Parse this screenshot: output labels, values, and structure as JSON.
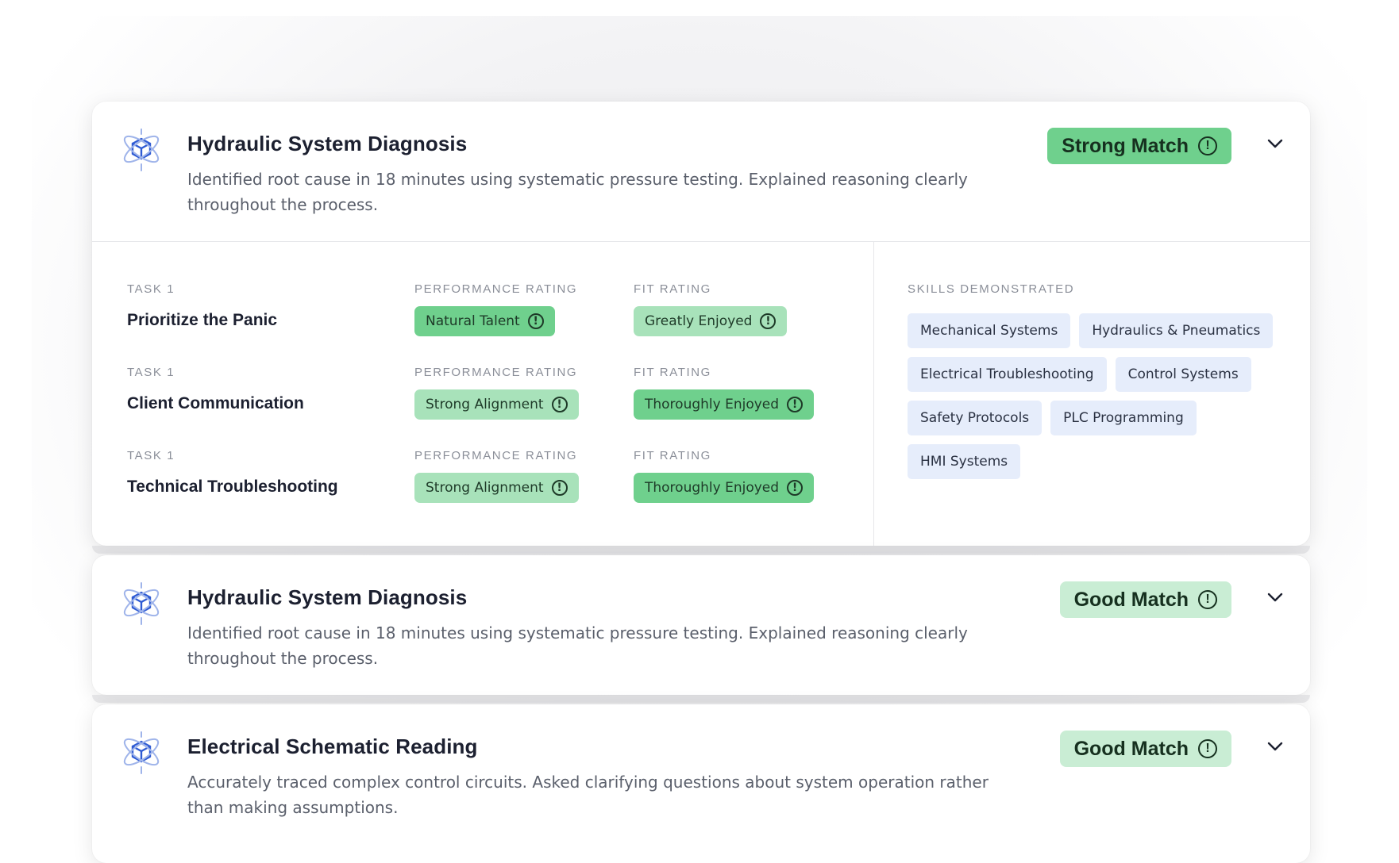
{
  "cards": [
    {
      "title": "Hydraulic System Diagnosis",
      "description": "Identified root cause in 18 minutes using systematic pressure testing. Explained reasoning clearly throughout the process.",
      "match": "Strong Match",
      "expanded": true,
      "tasks": [
        {
          "task_label": "TASK 1",
          "name": "Prioritize the Panic",
          "performance_label": "PERFORMANCE RATING",
          "performance": "Natural Talent",
          "fit_label": "FIT RATING",
          "fit": "Greatly Enjoyed"
        },
        {
          "task_label": "TASK 1",
          "name": "Client Communication",
          "performance_label": "PERFORMANCE RATING",
          "performance": "Strong Alignment",
          "fit_label": "FIT RATING",
          "fit": "Thoroughly Enjoyed"
        },
        {
          "task_label": "TASK 1",
          "name": "Technical Troubleshooting",
          "performance_label": "PERFORMANCE RATING",
          "performance": "Strong Alignment",
          "fit_label": "FIT RATING",
          "fit": "Thoroughly Enjoyed"
        }
      ],
      "skills_label": "SKILLS DEMONSTRATED",
      "skills": [
        "Mechanical Systems",
        "Hydraulics & Pneumatics",
        "Electrical Troubleshooting",
        "Control Systems",
        "Safety Protocols",
        "PLC Programming",
        "HMI Systems"
      ]
    },
    {
      "title": "Hydraulic System Diagnosis",
      "description": "Identified root cause in 18 minutes using systematic pressure testing. Explained reasoning clearly throughout the process.",
      "match": "Good Match",
      "expanded": false
    },
    {
      "title": "Electrical Schematic Reading",
      "description": "Accurately traced complex control circuits. Asked clarifying questions about system operation rather than making assumptions.",
      "match": "Good Match",
      "expanded": false
    }
  ],
  "icons": {
    "logo": "cube-atom-icon",
    "info": "info-circle-icon",
    "expand": "chevron-down-icon"
  },
  "colors": {
    "strong_match": "#6fd08d",
    "good_match": "#c9edd4",
    "skill_tag": "#e6edfb",
    "logo": "#2f5bd3"
  }
}
